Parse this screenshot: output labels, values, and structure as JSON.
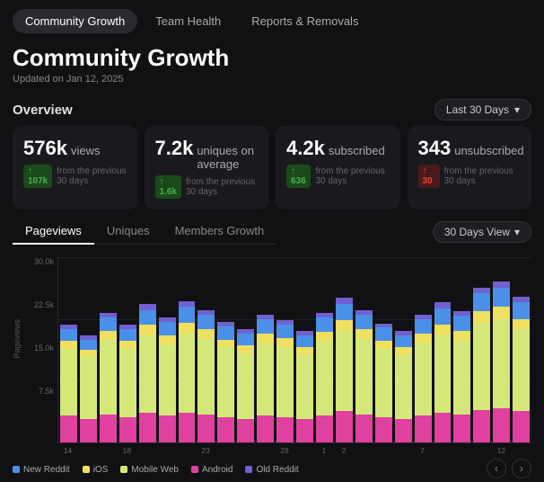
{
  "nav": {
    "tabs": [
      {
        "label": "Community Growth",
        "active": true
      },
      {
        "label": "Team Health",
        "active": false
      },
      {
        "label": "Reports & Removals",
        "active": false
      }
    ]
  },
  "header": {
    "title": "Community Growth",
    "subtitle": "Updated on Jan 12, 2025"
  },
  "overview": {
    "label": "Overview",
    "period": "Last 30 Days",
    "stats": [
      {
        "value": "576k",
        "unit": "views",
        "badge": "107k",
        "badge_type": "green",
        "badge_arrow": "↑",
        "desc": "from the previous 30 days"
      },
      {
        "value": "7.2k",
        "unit": "uniques on average",
        "badge": "1.6k",
        "badge_type": "green",
        "badge_arrow": "↑",
        "desc": "from the previous 30 days"
      },
      {
        "value": "4.2k",
        "unit": "subscribed",
        "badge": "636",
        "badge_type": "green",
        "badge_arrow": "↑",
        "desc": "from the previous 30 days"
      },
      {
        "value": "343",
        "unit": "unsubscribed",
        "badge": "30",
        "badge_type": "red",
        "badge_arrow": "↑",
        "desc": "from the previous 30 days"
      }
    ]
  },
  "chart": {
    "tabs": [
      "Pageviews",
      "Uniques",
      "Members Growth"
    ],
    "active_tab": 0,
    "view_select": "30 Days View",
    "y_labels": [
      "30.0k",
      "22.5k",
      "15.0k",
      "7.5k",
      ""
    ],
    "y_axis_label": "Pageviews",
    "x_labels": [
      "14",
      "",
      "",
      "18",
      "",
      "",
      "",
      "23",
      "",
      "",
      "",
      "28",
      "",
      "1",
      "2",
      "",
      "",
      "",
      "7",
      "",
      "",
      "",
      "12",
      ""
    ],
    "legend": [
      {
        "label": "New Reddit",
        "color": "#4a90e8"
      },
      {
        "label": "iOS",
        "color": "#f0e060"
      },
      {
        "label": "Mobile Web",
        "color": "#d4e87a"
      },
      {
        "label": "Android",
        "color": "#e040a0"
      },
      {
        "label": "Old Reddit",
        "color": "#7060d0"
      }
    ],
    "bars": [
      {
        "new_reddit": 8,
        "ios": 5,
        "mobile": 45,
        "android": 18,
        "old": 3
      },
      {
        "new_reddit": 7,
        "ios": 4,
        "mobile": 42,
        "android": 16,
        "old": 3
      },
      {
        "new_reddit": 9,
        "ios": 6,
        "mobile": 50,
        "android": 19,
        "old": 3
      },
      {
        "new_reddit": 8,
        "ios": 5,
        "mobile": 46,
        "android": 17,
        "old": 3
      },
      {
        "new_reddit": 10,
        "ios": 7,
        "mobile": 52,
        "android": 20,
        "old": 4
      },
      {
        "new_reddit": 9,
        "ios": 6,
        "mobile": 48,
        "android": 18,
        "old": 3
      },
      {
        "new_reddit": 11,
        "ios": 7,
        "mobile": 53,
        "android": 20,
        "old": 4
      },
      {
        "new_reddit": 10,
        "ios": 6,
        "mobile": 51,
        "android": 19,
        "old": 3
      },
      {
        "new_reddit": 9,
        "ios": 5,
        "mobile": 47,
        "android": 17,
        "old": 3
      },
      {
        "new_reddit": 8,
        "ios": 5,
        "mobile": 44,
        "android": 16,
        "old": 3
      },
      {
        "new_reddit": 10,
        "ios": 6,
        "mobile": 49,
        "android": 18,
        "old": 3
      },
      {
        "new_reddit": 9,
        "ios": 6,
        "mobile": 47,
        "android": 17,
        "old": 3
      },
      {
        "new_reddit": 8,
        "ios": 5,
        "mobile": 43,
        "android": 16,
        "old": 3
      },
      {
        "new_reddit": 10,
        "ios": 6,
        "mobile": 50,
        "android": 18,
        "old": 3
      },
      {
        "new_reddit": 11,
        "ios": 7,
        "mobile": 54,
        "android": 21,
        "old": 4
      },
      {
        "new_reddit": 10,
        "ios": 6,
        "mobile": 51,
        "android": 19,
        "old": 3
      },
      {
        "new_reddit": 9,
        "ios": 5,
        "mobile": 46,
        "android": 17,
        "old": 3
      },
      {
        "new_reddit": 8,
        "ios": 5,
        "mobile": 43,
        "android": 16,
        "old": 3
      },
      {
        "new_reddit": 10,
        "ios": 6,
        "mobile": 49,
        "android": 18,
        "old": 3
      },
      {
        "new_reddit": 11,
        "ios": 7,
        "mobile": 52,
        "android": 20,
        "old": 4
      },
      {
        "new_reddit": 10,
        "ios": 6,
        "mobile": 50,
        "android": 19,
        "old": 3
      },
      {
        "new_reddit": 12,
        "ios": 8,
        "mobile": 58,
        "android": 22,
        "old": 4
      },
      {
        "new_reddit": 13,
        "ios": 8,
        "mobile": 60,
        "android": 23,
        "old": 4
      },
      {
        "new_reddit": 11,
        "ios": 7,
        "mobile": 55,
        "android": 21,
        "old": 4
      }
    ]
  }
}
